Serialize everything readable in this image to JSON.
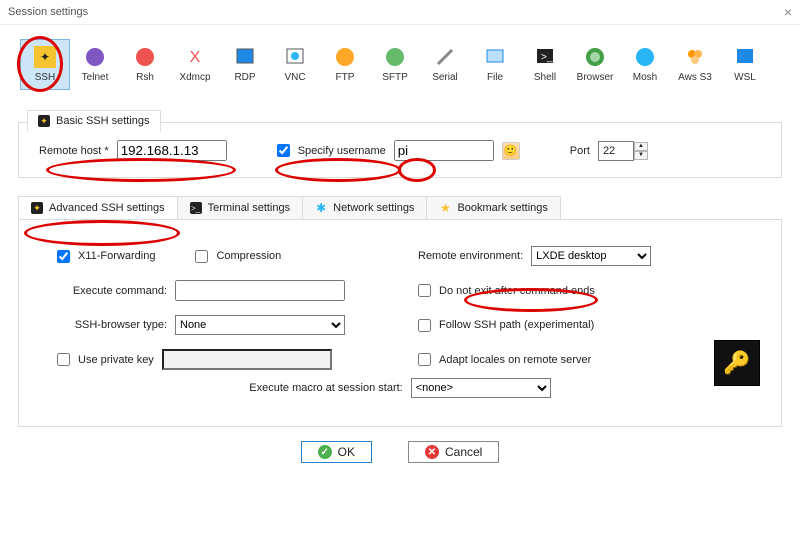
{
  "window": {
    "title": "Session settings"
  },
  "toolbar": {
    "items": [
      {
        "id": "ssh",
        "label": "SSH"
      },
      {
        "id": "telnet",
        "label": "Telnet"
      },
      {
        "id": "rsh",
        "label": "Rsh"
      },
      {
        "id": "xdmcp",
        "label": "Xdmcp"
      },
      {
        "id": "rdp",
        "label": "RDP"
      },
      {
        "id": "vnc",
        "label": "VNC"
      },
      {
        "id": "ftp",
        "label": "FTP"
      },
      {
        "id": "sftp",
        "label": "SFTP"
      },
      {
        "id": "serial",
        "label": "Serial"
      },
      {
        "id": "file",
        "label": "File"
      },
      {
        "id": "shell",
        "label": "Shell"
      },
      {
        "id": "browser",
        "label": "Browser"
      },
      {
        "id": "mosh",
        "label": "Mosh"
      },
      {
        "id": "awss3",
        "label": "Aws S3"
      },
      {
        "id": "wsl",
        "label": "WSL"
      }
    ]
  },
  "basic": {
    "tab_label": "Basic SSH settings",
    "remote_host_label": "Remote host *",
    "remote_host_value": "192.168.1.13",
    "specify_username_label": "Specify username",
    "specify_username_checked": true,
    "username_value": "pi",
    "port_label": "Port",
    "port_value": "22"
  },
  "subtabs": {
    "advanced": "Advanced SSH settings",
    "terminal": "Terminal settings",
    "network": "Network settings",
    "bookmark": "Bookmark settings"
  },
  "advanced": {
    "x11_label": "X11-Forwarding",
    "x11_checked": true,
    "compression_label": "Compression",
    "compression_checked": false,
    "remote_env_label": "Remote environment:",
    "remote_env_value": "LXDE desktop",
    "execute_command_label": "Execute command:",
    "execute_command_value": "",
    "do_not_exit_label": "Do not exit after command ends",
    "do_not_exit_checked": false,
    "ssh_browser_label": "SSH-browser type:",
    "ssh_browser_value": "None",
    "follow_path_label": "Follow SSH path (experimental)",
    "follow_path_checked": false,
    "use_private_key_label": "Use private key",
    "use_private_key_checked": false,
    "private_key_value": "",
    "adapt_locales_label": "Adapt locales on remote server",
    "adapt_locales_checked": false,
    "macro_label": "Execute macro at session start:",
    "macro_value": "<none>"
  },
  "buttons": {
    "ok": "OK",
    "cancel": "Cancel"
  }
}
